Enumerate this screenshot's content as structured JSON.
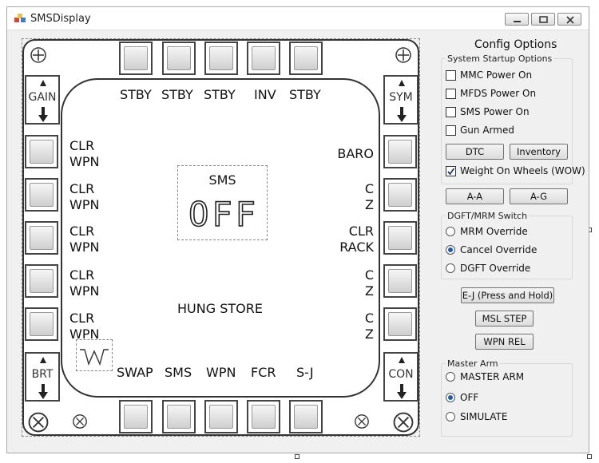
{
  "window": {
    "title": "SMSDisplay"
  },
  "mfd": {
    "top_labels": [
      "STBY",
      "STBY",
      "STBY",
      "INV",
      "STBY"
    ],
    "bottom_labels": [
      "SWAP",
      "SMS",
      "WPN",
      "FCR",
      "S-J"
    ],
    "left_labels": [
      {
        "l1": "CLR",
        "l2": "WPN"
      },
      {
        "l1": "CLR",
        "l2": "WPN"
      },
      {
        "l1": "CLR",
        "l2": "WPN"
      },
      {
        "l1": "CLR",
        "l2": "WPN"
      },
      {
        "l1": "CLR",
        "l2": "WPN"
      }
    ],
    "right_labels": [
      {
        "l1": "BARO",
        "l2": ""
      },
      {
        "l1": "C",
        "l2": "Z"
      },
      {
        "l1": "CLR",
        "l2": "RACK"
      },
      {
        "l1": "C",
        "l2": "Z"
      },
      {
        "l1": "C",
        "l2": "Z"
      }
    ],
    "rockers": {
      "gain": "GAIN",
      "sym": "SYM",
      "brt": "BRT",
      "con": "CON"
    },
    "sms_title": "SMS",
    "sms_mode": "OFF",
    "status_text": "HUNG STORE"
  },
  "config": {
    "title": "Config Options",
    "startup": {
      "title": "System Startup Options",
      "options": [
        {
          "label": "MMC Power On",
          "checked": false
        },
        {
          "label": "MFDS Power On",
          "checked": false
        },
        {
          "label": "SMS Power On",
          "checked": false
        },
        {
          "label": "Gun Armed",
          "checked": false
        }
      ],
      "dtc_label": "DTC",
      "inventory_label": "Inventory",
      "wow": {
        "label": "Weight On Wheels (WOW)",
        "checked": true
      }
    },
    "aa_label": "A-A",
    "ag_label": "A-G",
    "dgft": {
      "title": "DGFT/MRM Switch",
      "options": [
        {
          "label": "MRM Override",
          "selected": false
        },
        {
          "label": "Cancel Override",
          "selected": true
        },
        {
          "label": "DGFT Override",
          "selected": false
        }
      ]
    },
    "ej_label": "E-J (Press and Hold)",
    "msl_step_label": "MSL STEP",
    "wpn_rel_label": "WPN REL",
    "master_arm": {
      "title": "Master Arm",
      "options": [
        {
          "label": "MASTER ARM",
          "selected": false
        },
        {
          "label": "OFF",
          "selected": true
        },
        {
          "label": "SIMULATE",
          "selected": false
        }
      ]
    }
  }
}
